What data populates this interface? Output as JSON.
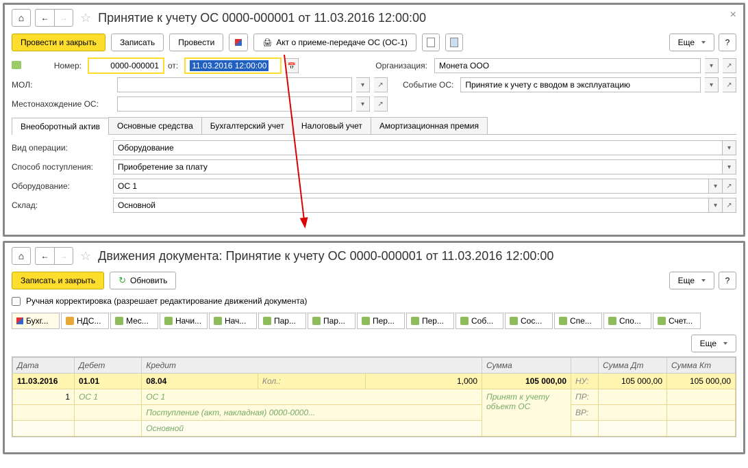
{
  "panel1": {
    "title": "Принятие к учету ОС 0000-000001 от 11.03.2016 12:00:00",
    "toolbar": {
      "post_close": "Провести и закрыть",
      "save": "Записать",
      "post": "Провести",
      "print_act": "Акт о приеме-передаче ОС (ОС-1)",
      "more": "Еще",
      "help": "?"
    },
    "fields": {
      "number_label": "Номер:",
      "number_value": "0000-000001",
      "from_label": "от:",
      "date_value": "11.03.2016 12:00:00",
      "org_label": "Организация:",
      "org_value": "Монета ООО",
      "mol_label": "МОЛ:",
      "event_label": "Событие ОС:",
      "event_value": "Принятие к учету с вводом в эксплуатацию",
      "location_label": "Местонахождение ОС:"
    },
    "tabs": [
      "Внеоборотный актив",
      "Основные средства",
      "Бухгалтерский учет",
      "Налоговый учет",
      "Амортизационная премия"
    ],
    "detail": {
      "op_label": "Вид операции:",
      "op_value": "Оборудование",
      "method_label": "Способ поступления:",
      "method_value": "Приобретение за плату",
      "equip_label": "Оборудование:",
      "equip_value": "ОС 1",
      "store_label": "Склад:",
      "store_value": "Основной"
    }
  },
  "panel2": {
    "title": "Движения документа: Принятие к учету ОС 0000-000001 от 11.03.2016 12:00:00",
    "toolbar": {
      "save_close": "Записать и закрыть",
      "refresh": "Обновить",
      "more": "Еще",
      "help": "?"
    },
    "manual_label": "Ручная корректировка (разрешает редактирование движений документа)",
    "mini_tabs": [
      "Бухг...",
      "НДС...",
      "Мес...",
      "Начи...",
      "Нач...",
      "Пар...",
      "Пар...",
      "Пер...",
      "Пер...",
      "Соб...",
      "Сос...",
      "Спе...",
      "Спо...",
      "Счет..."
    ],
    "table": {
      "headers": {
        "date": "Дата",
        "debit": "Дебет",
        "credit": "Кредит",
        "sum": "Сумма",
        "sum_dt": "Сумма Дт",
        "sum_kt": "Сумма Кт"
      },
      "more": "Еще",
      "r1": {
        "date": "11.03.2016",
        "debit": "01.01",
        "credit": "08.04",
        "qty_l": "Кол.:",
        "qty": "1,000",
        "sum": "105 000,00",
        "nu": "НУ:",
        "sum_dt": "105 000,00",
        "sum_kt": "105 000,00"
      },
      "r2": {
        "idx": "1",
        "debit": "ОС 1",
        "credit": "ОС 1",
        "desc": "Принят к учету объект ОС",
        "pr": "ПР:"
      },
      "r3": {
        "credit": "Поступление (акт, накладная) 0000-0000...",
        "vr": "ВР:"
      },
      "r4": {
        "credit": "Основной"
      }
    }
  }
}
